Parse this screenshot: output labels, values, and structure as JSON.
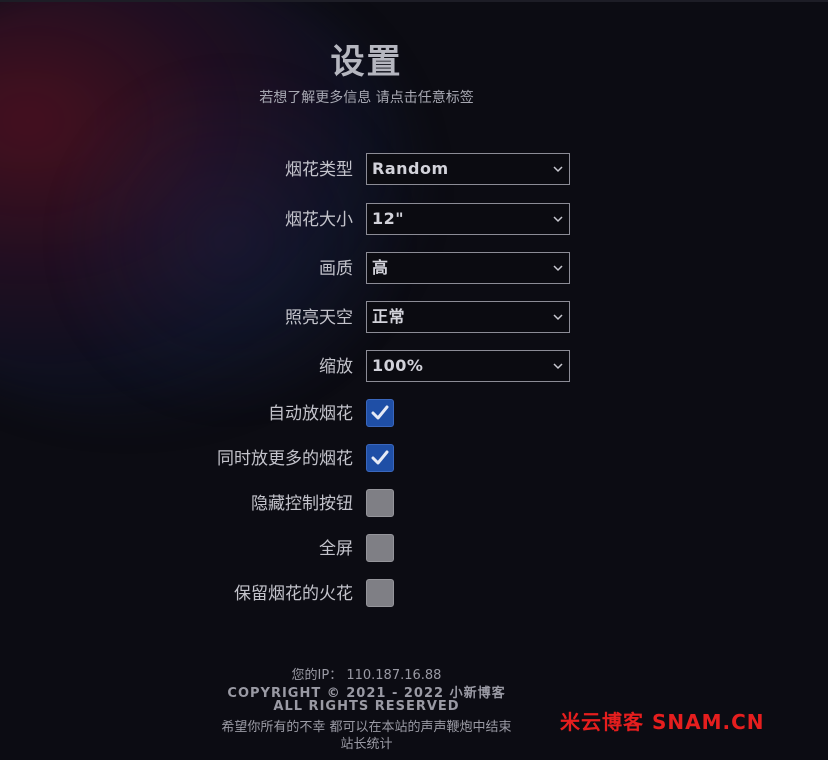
{
  "header": {
    "title": "设置",
    "subtitle": "若想了解更多信息 请点击任意标签"
  },
  "selects": [
    {
      "label": "烟花类型",
      "value": "Random"
    },
    {
      "label": "烟花大小",
      "value": "12\""
    },
    {
      "label": "画质",
      "value": "高"
    },
    {
      "label": "照亮天空",
      "value": "正常"
    },
    {
      "label": "缩放",
      "value": "100%"
    }
  ],
  "checkboxes": [
    {
      "label": "自动放烟花",
      "checked": true
    },
    {
      "label": "同时放更多的烟花",
      "checked": true
    },
    {
      "label": "隐藏控制按钮",
      "checked": false
    },
    {
      "label": "全屏",
      "checked": false
    },
    {
      "label": "保留烟花的火花",
      "checked": false
    }
  ],
  "footer": {
    "ip_line": "您的IP： 110.187.16.88",
    "copyright": "COPYRIGHT © 2021 - 2022 小新博客",
    "rights": "ALL RIGHTS RESERVED",
    "wish": "希望你所有的不幸 都可以在本站的声声鞭炮中结束",
    "stats": "站长统计"
  },
  "watermark": "米云博客  SNAM.CN",
  "colors": {
    "checkbox_on": "#1f4fa6",
    "checkbox_off": "#7f7f85",
    "watermark": "#e61e1e",
    "background": "#0c0c13"
  },
  "icons": {
    "select_arrow": "chevron-down-icon",
    "checkbox_mark": "checkmark-icon"
  }
}
